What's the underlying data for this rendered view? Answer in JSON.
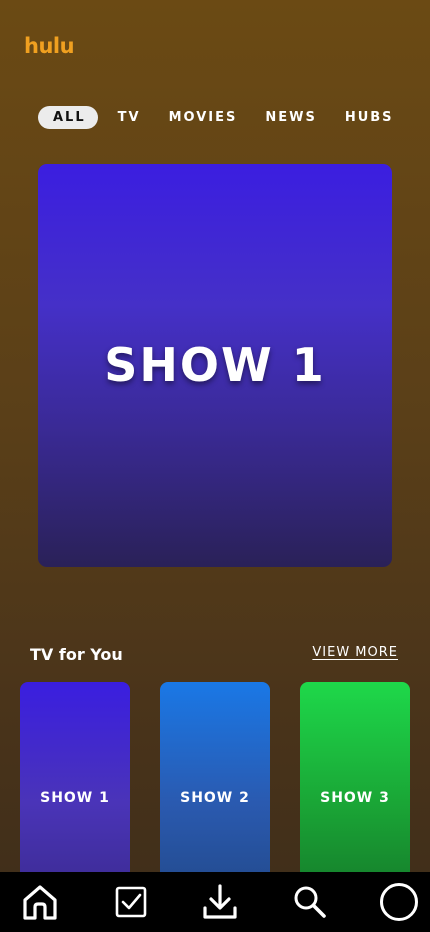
{
  "app": {
    "logo": "hulu"
  },
  "tabs": [
    {
      "label": "ALL"
    },
    {
      "label": "TV"
    },
    {
      "label": "MOVIES"
    },
    {
      "label": "NEWS"
    },
    {
      "label": "HUBS"
    }
  ],
  "active_tab": "ALL",
  "hero": {
    "title": "SHOW 1"
  },
  "section": {
    "title": "TV for You",
    "view_more": "VIEW MORE",
    "cards": [
      {
        "title": "SHOW 1"
      },
      {
        "title": "SHOW 2"
      },
      {
        "title": "SHOW 3"
      }
    ]
  },
  "bottom_nav": {
    "items": [
      {
        "icon": "home-icon"
      },
      {
        "icon": "checkbox-icon"
      },
      {
        "icon": "download-icon"
      },
      {
        "icon": "search-icon"
      },
      {
        "icon": "profile-circle-icon"
      }
    ]
  },
  "colors": {
    "brand": "#f0a020",
    "background_top": "#6b4a14",
    "background_bottom": "#3e2d1a",
    "nav_background": "#000000"
  }
}
